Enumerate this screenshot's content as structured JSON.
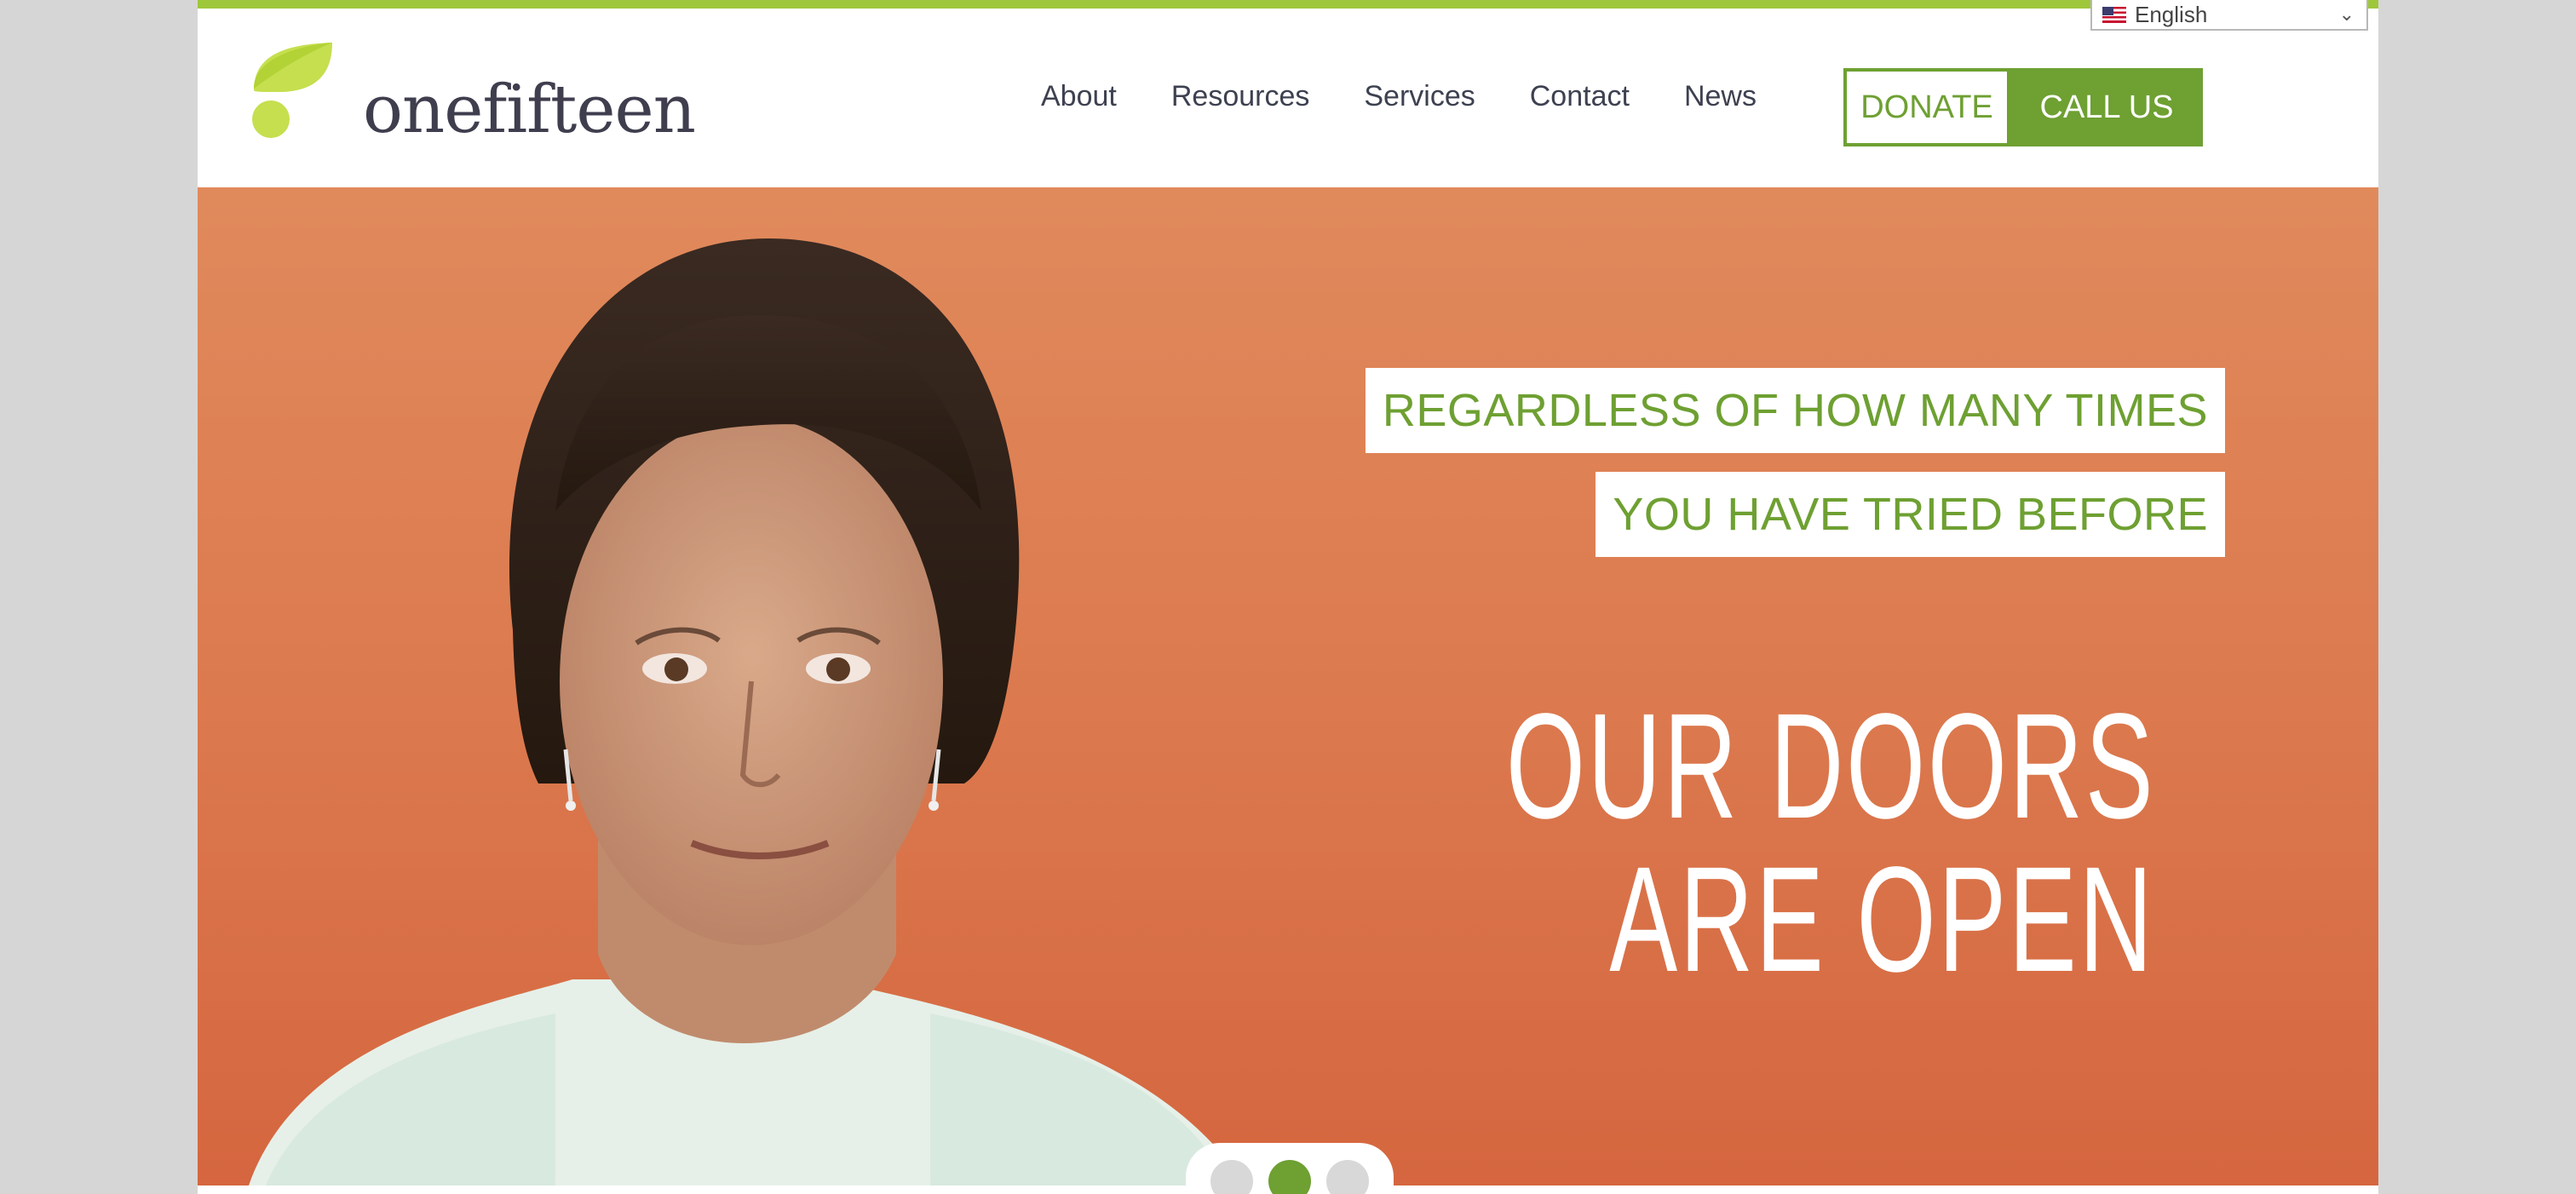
{
  "brand": {
    "name": "onefifteen",
    "accent_color": "#6ea032",
    "leaf_color": "#b8d94a"
  },
  "language_selector": {
    "flag_icon": "us-flag-icon",
    "selected": "English"
  },
  "nav": {
    "items": [
      {
        "label": "About"
      },
      {
        "label": "Resources"
      },
      {
        "label": "Services"
      },
      {
        "label": "Contact"
      },
      {
        "label": "News"
      }
    ]
  },
  "header_buttons": {
    "donate_label": "DONATE",
    "call_label": "CALL US"
  },
  "hero": {
    "tagline_line1": "REGARDLESS OF HOW MANY TIMES",
    "tagline_line2": "YOU HAVE TRIED BEFORE",
    "headline_line1": "OUR DOORS",
    "headline_line2": "ARE OPEN",
    "background_color": "#dc7a4f"
  },
  "carousel": {
    "slide_count": 3,
    "active_index": 1
  }
}
